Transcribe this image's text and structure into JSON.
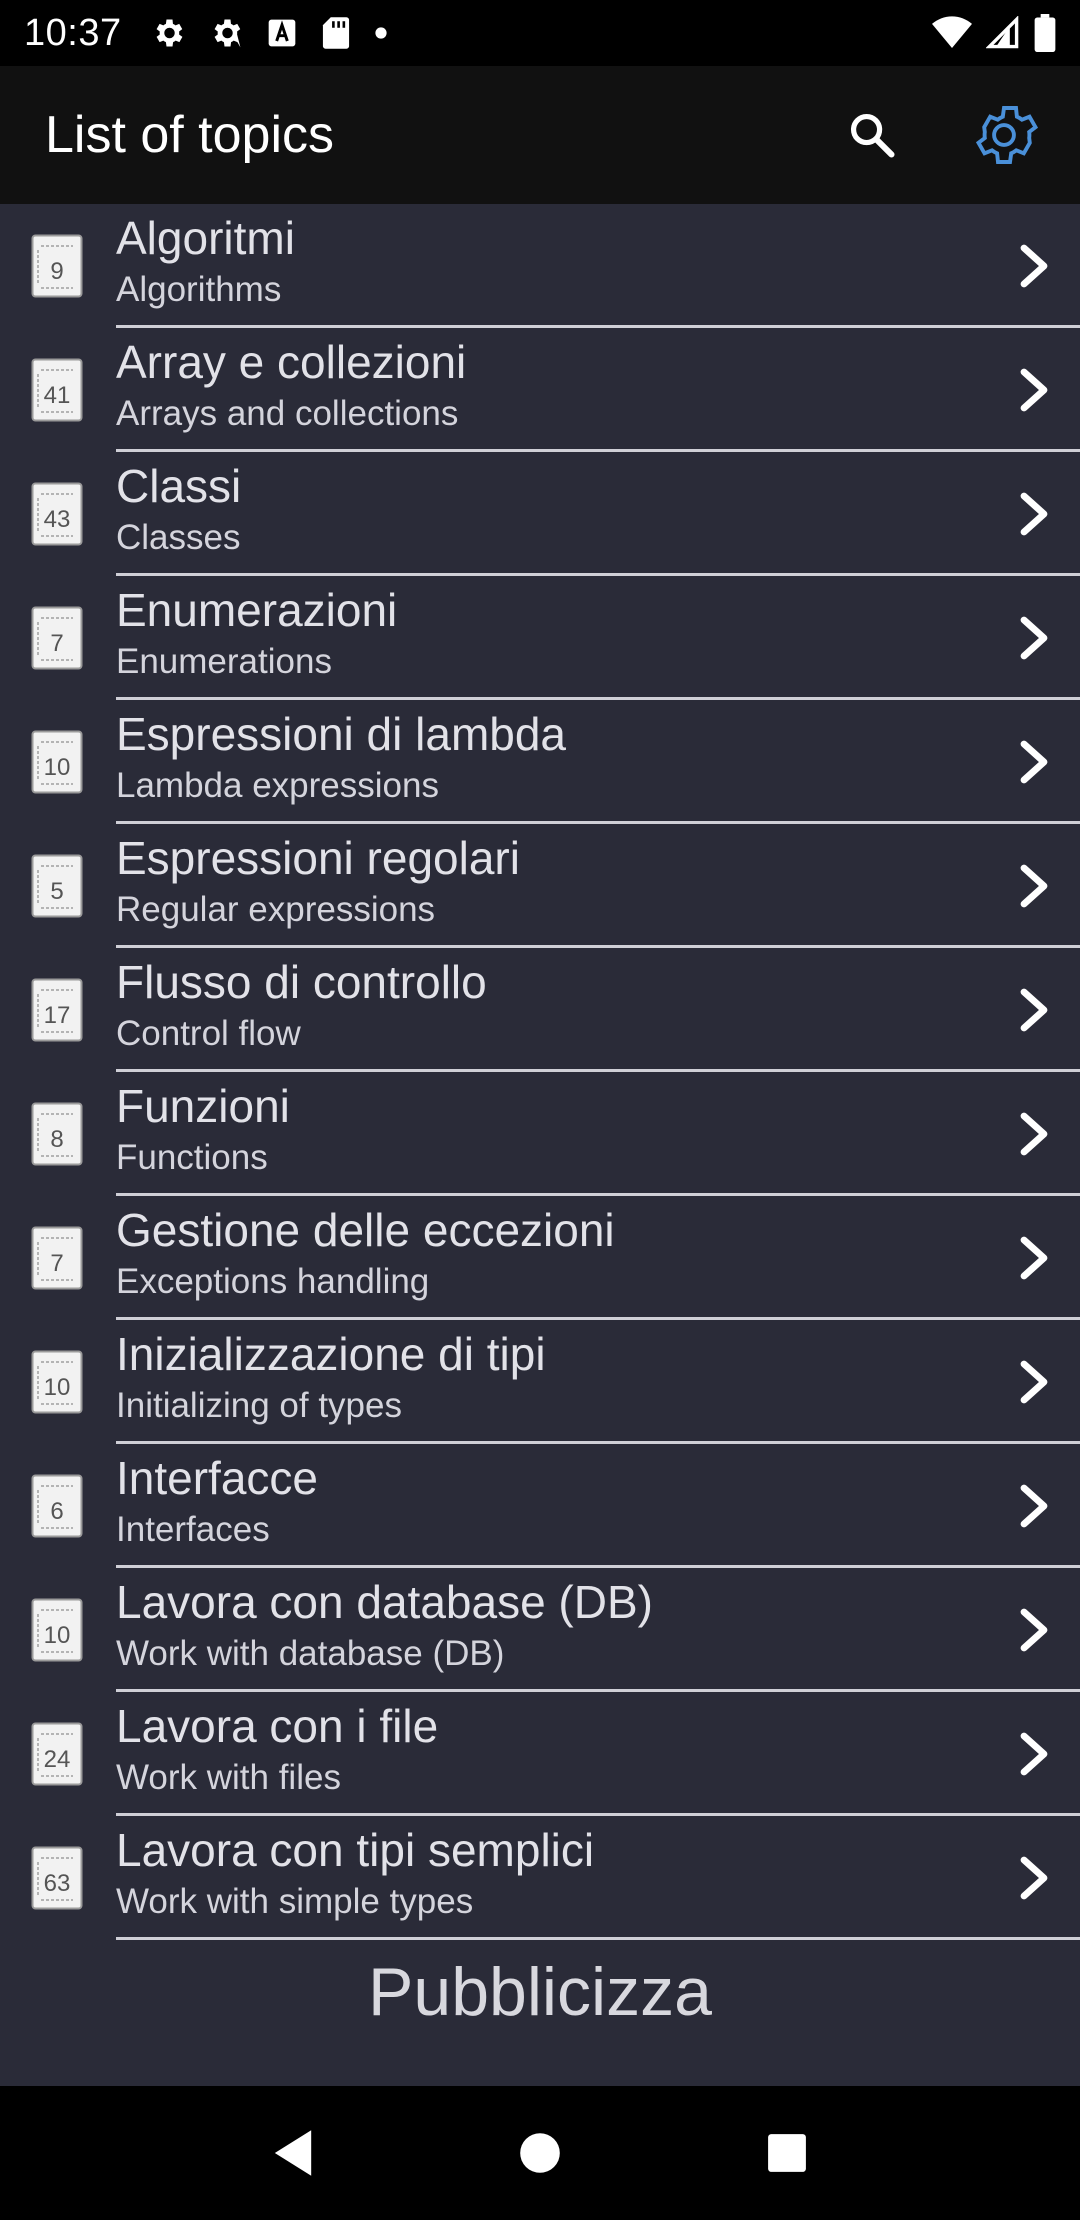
{
  "status_bar": {
    "time": "10:37",
    "left_icons": [
      "gear-icon",
      "gear-icon",
      "text-a-icon",
      "sd-card-icon",
      "dot-icon"
    ],
    "right_icons": [
      "wifi-icon",
      "signal-icon",
      "battery-icon"
    ]
  },
  "app_bar": {
    "title": "List of topics",
    "search_icon": "search-icon",
    "settings_icon": "gear-icon",
    "settings_color": "#4a90d9"
  },
  "topics": [
    {
      "count": "9",
      "title": "Algoritmi",
      "subtitle": "Algorithms"
    },
    {
      "count": "41",
      "title": "Array e collezioni",
      "subtitle": "Arrays and collections"
    },
    {
      "count": "43",
      "title": "Classi",
      "subtitle": "Classes"
    },
    {
      "count": "7",
      "title": "Enumerazioni",
      "subtitle": "Enumerations"
    },
    {
      "count": "10",
      "title": "Espressioni di lambda",
      "subtitle": "Lambda expressions"
    },
    {
      "count": "5",
      "title": "Espressioni regolari",
      "subtitle": "Regular expressions"
    },
    {
      "count": "17",
      "title": "Flusso di controllo",
      "subtitle": "Control flow"
    },
    {
      "count": "8",
      "title": "Funzioni",
      "subtitle": "Functions"
    },
    {
      "count": "7",
      "title": "Gestione delle eccezioni",
      "subtitle": "Exceptions handling"
    },
    {
      "count": "10",
      "title": "Inizializzazione di tipi",
      "subtitle": "Initializing of types"
    },
    {
      "count": "6",
      "title": "Interfacce",
      "subtitle": "Interfaces"
    },
    {
      "count": "10",
      "title": "Lavora con database (DB)",
      "subtitle": "Work with database (DB)"
    },
    {
      "count": "24",
      "title": "Lavora con i file",
      "subtitle": "Work with files"
    },
    {
      "count": "63",
      "title": "Lavora con tipi semplici",
      "subtitle": "Work with simple types"
    }
  ],
  "ad": {
    "label": "Pubblicizza"
  },
  "nav_bar": {
    "icons": [
      "back-icon",
      "home-icon",
      "recents-icon"
    ]
  },
  "colors": {
    "list_bg": "#2a2b38",
    "app_bar_bg": "#111111",
    "accent": "#4a90d9"
  }
}
